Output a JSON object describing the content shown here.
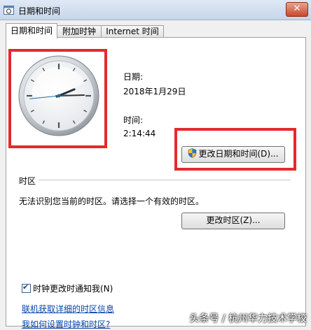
{
  "window": {
    "title": "日期和时间",
    "close_glyph": "✕"
  },
  "tabs": [
    {
      "label": "日期和时间",
      "active": true
    },
    {
      "label": "附加时钟",
      "active": false
    },
    {
      "label": "Internet 时间",
      "active": false
    }
  ],
  "datetime": {
    "date_label": "日期:",
    "date_value": "2018年1月29日",
    "time_label": "时间:",
    "time_value": "2:14:44",
    "change_button": "更改日期和时间(D)..."
  },
  "clock": {
    "hours": 2,
    "minutes": 14,
    "seconds": 44
  },
  "timezone": {
    "section_label": "时区",
    "message": "无法识别您当前的时区。请选择一个有效的时区。",
    "change_button": "更改时区(Z)..."
  },
  "notify": {
    "label": "时钟更改时通知我(N)",
    "checked": true,
    "check_glyph": "✔"
  },
  "links": {
    "online_info": "联机获取详细的时区信息",
    "how_to": "我如何设置时钟和时区?"
  },
  "watermark": "头条号 / 杭州华力技术学校",
  "colors": {
    "highlight_red": "#e32a2a",
    "link_blue": "#0645ad"
  },
  "icons": {
    "title": "clock-calendar-icon",
    "shield": "uac-shield-icon"
  }
}
